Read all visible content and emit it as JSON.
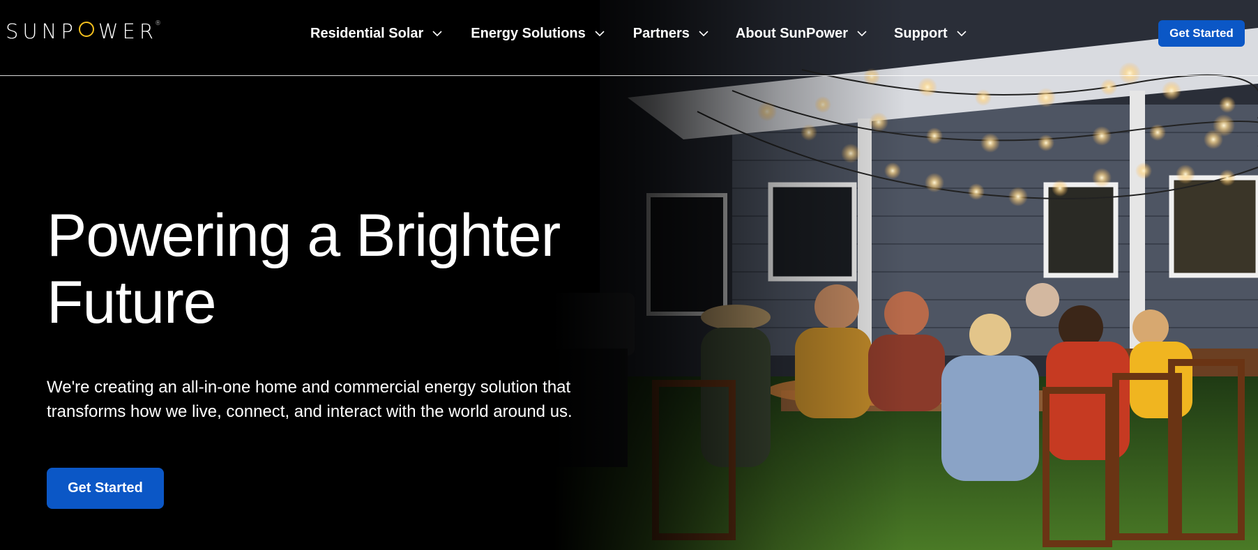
{
  "brand": {
    "logo_text_left": "SUNP",
    "logo_text_right": "WER",
    "registered_mark": "®",
    "logo_accent": "#f4c01e"
  },
  "nav": {
    "items": [
      {
        "label": "Residential Solar"
      },
      {
        "label": "Energy Solutions"
      },
      {
        "label": "Partners"
      },
      {
        "label": "About SunPower"
      },
      {
        "label": "Support"
      }
    ],
    "cta_label": "Get Started"
  },
  "hero": {
    "title_line1": "Powering a Brighter",
    "title_line2": "Future",
    "subtitle_line1": "We're creating an all-in-one home and commercial energy solution that",
    "subtitle_line2": "transforms how we live, connect, and interact with the world around us.",
    "cta_label": "Get Started"
  },
  "colors": {
    "background": "#000000",
    "accent_blue": "#0b57c6",
    "text": "#ffffff"
  }
}
